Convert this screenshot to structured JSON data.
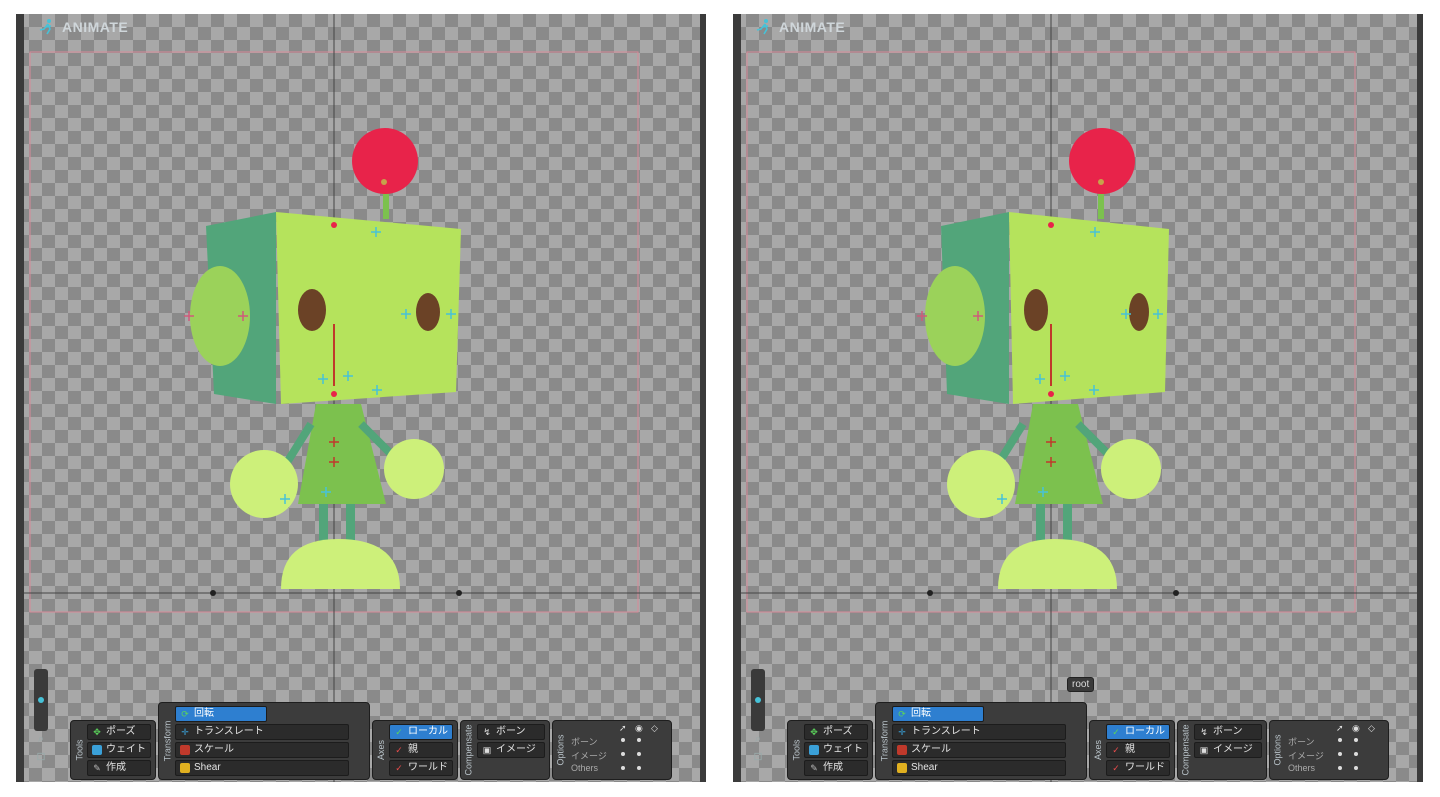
{
  "panes": [
    {
      "id": "left",
      "header": {
        "app_name": "ANIMATE"
      }
    },
    {
      "id": "right",
      "header": {
        "app_name": "ANIMATE"
      },
      "tooltip": "root"
    }
  ],
  "toolbar": {
    "tools": {
      "label": "Tools",
      "items": [
        "ポーズ",
        "ウェイト",
        "作成"
      ],
      "active": -1
    },
    "transform": {
      "label": "Transform",
      "items": [
        "回転",
        "トランスレート",
        "スケール",
        "Shear"
      ],
      "active": 0
    },
    "axes": {
      "label": "Axes",
      "items": [
        "ローカル",
        "親",
        "ワールド"
      ],
      "active": 0
    },
    "compensate": {
      "label": "Compensate",
      "items": [
        "ボーン",
        "イメージ"
      ]
    },
    "options": {
      "label": "Options",
      "rows": [
        "ボーン",
        "イメージ",
        "Others"
      ]
    }
  },
  "icons": {
    "app": "running-figure-icon",
    "pose": "pose-icon",
    "weight": "weight-icon",
    "create": "pencil-icon",
    "rotate": "rotate-icon",
    "translate": "move-icon",
    "scale": "scale-icon",
    "shear": "shear-icon",
    "zoom": "magnifier-icon",
    "fit": "fit-icon"
  },
  "colors": {
    "accent": "#2e7fd0",
    "robot_head_front": "#b5e35c",
    "robot_head_side": "#52a57a",
    "robot_antenna_ball": "#e8234a",
    "robot_eye": "#6b4226",
    "robot_limb": "#cdf07a",
    "robot_body": "#7cc14e"
  }
}
